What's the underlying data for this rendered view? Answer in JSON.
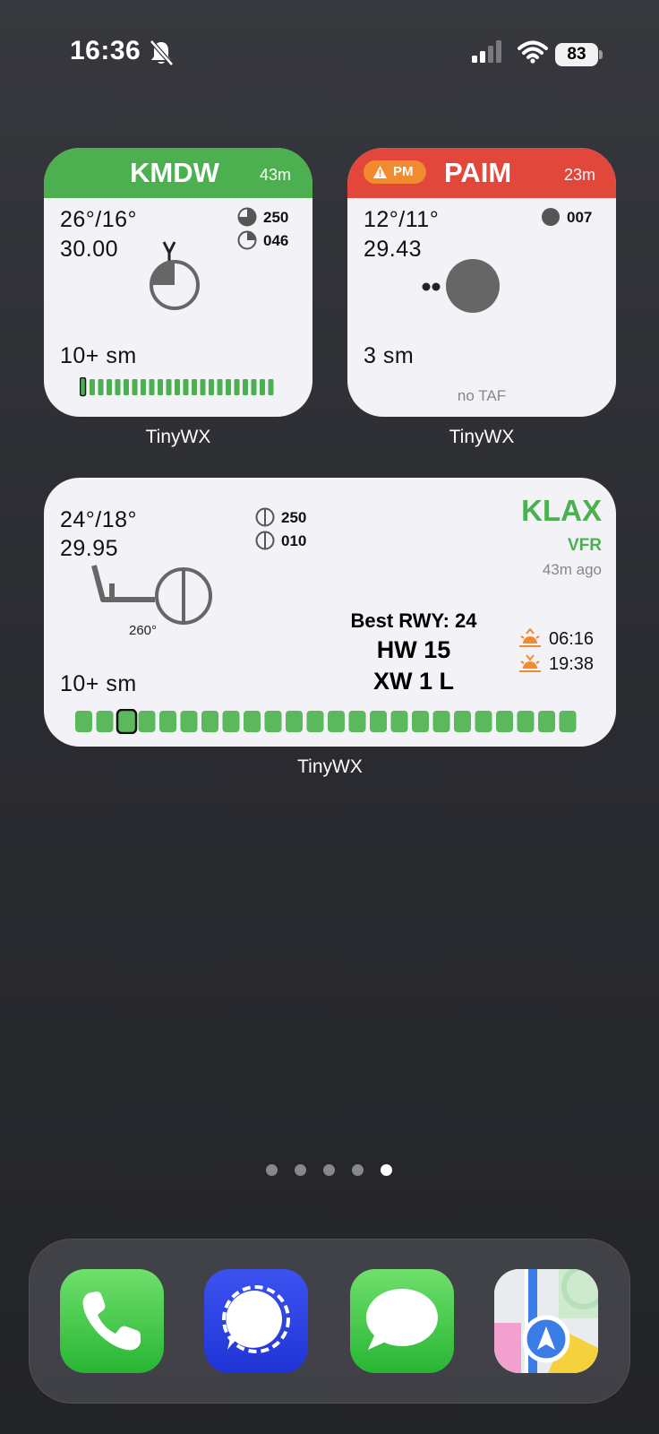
{
  "status_bar": {
    "time": "16:36",
    "battery": "83"
  },
  "widgets": {
    "kmdw": {
      "station": "KMDW",
      "age": "43m",
      "temp_dew": "26°/16°",
      "altimeter": "30.00",
      "clouds": [
        "250",
        "046"
      ],
      "visibility": "10+ sm",
      "header_color": "#4cb050"
    },
    "paim": {
      "station": "PAIM",
      "age": "23m",
      "badge": "PM",
      "temp_dew": "12°/11°",
      "altimeter": "29.43",
      "clouds": [
        "007"
      ],
      "visibility": "3 sm",
      "taf": "no TAF",
      "header_color": "#e2473c",
      "badge_color": "#f28a2e"
    },
    "klax": {
      "station": "KLAX",
      "category": "VFR",
      "age": "43m ago",
      "temp_dew": "24°/18°",
      "altimeter": "29.95",
      "clouds": [
        "250",
        "010"
      ],
      "wind_dir": "260°",
      "best_runway": "Best RWY: 24",
      "headwind": "HW 15",
      "crosswind": "XW 1 L",
      "sunrise": "06:16",
      "sunset": "19:38",
      "visibility": "10+ sm",
      "accent_color": "#4cb050"
    }
  },
  "widget_labels": [
    "TinyWX",
    "TinyWX",
    "TinyWX"
  ],
  "page_dots": {
    "count": 5,
    "active": 5
  },
  "dock": [
    "Phone",
    "Signal",
    "Messages",
    "Maps"
  ]
}
